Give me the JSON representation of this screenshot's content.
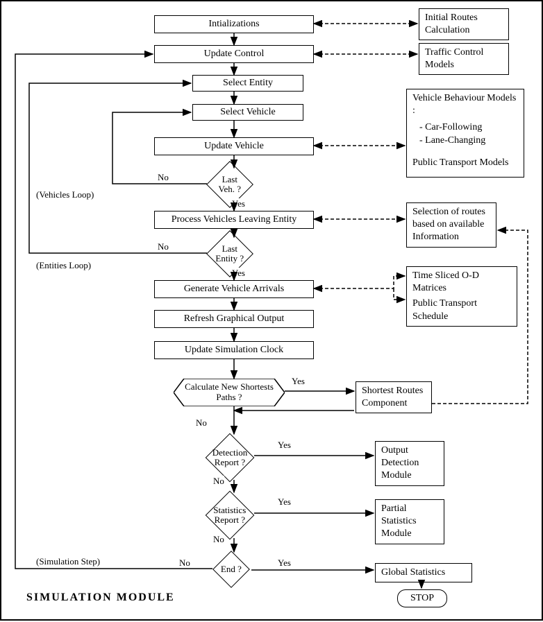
{
  "flow": {
    "init": "Intializations",
    "update_control": "Update Control",
    "select_entity": "Select Entity",
    "select_vehicle": "Select Vehicle",
    "update_vehicle": "Update Vehicle",
    "last_veh": "Last Veh. ?",
    "process_leaving": "Process Vehicles Leaving Entity",
    "last_entity": "Last Entity ?",
    "gen_arrivals": "Generate Vehicle Arrivals",
    "refresh_gfx": "Refresh Graphical Output",
    "update_clock": "Update Simulation Clock",
    "calc_paths": "Calculate  New Shortests Paths ?",
    "detection": "Detection Report ?",
    "statistics": "Statistics Report ?",
    "end": "End ?",
    "stop": "STOP"
  },
  "notes": {
    "initial_routes": "Initial Routes Calculation",
    "traffic_models": "Traffic Control Models",
    "veh_behaviour_title": "Vehicle Behaviour Models :",
    "veh_behaviour_1": "- Car-Following",
    "veh_behaviour_2": "- Lane-Changing",
    "veh_behaviour_3": "Public Transport Models",
    "route_selection": "Selection of routes based on available Information",
    "od_matrices_1": "Time Sliced O-D Matrices",
    "od_matrices_2": "Public Transport Schedule",
    "shortest_routes": "Shortest Routes Component",
    "output_detection": "Output Detection Module",
    "partial_stats": "Partial Statistics Module",
    "global_stats": "Global Statistics"
  },
  "labels": {
    "yes": "Yes",
    "no": "No",
    "vehicles_loop": "(Vehicles Loop)",
    "entities_loop": "(Entities Loop)",
    "sim_step": "(Simulation Step)"
  },
  "title": "SIMULATION  MODULE"
}
